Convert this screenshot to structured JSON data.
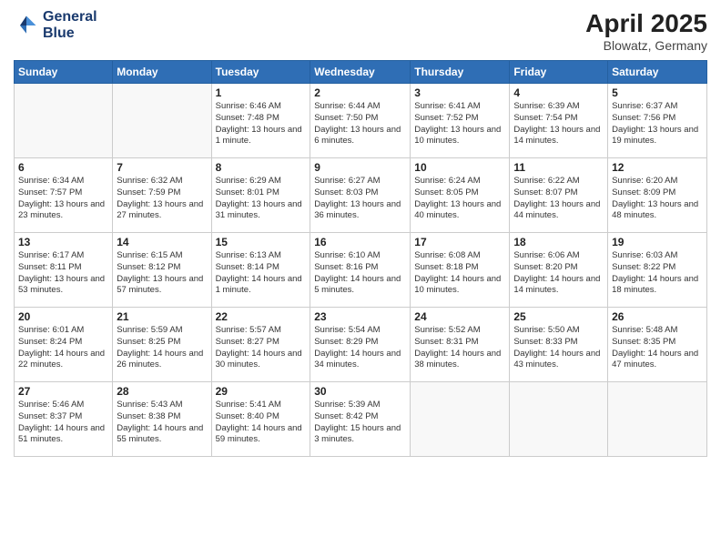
{
  "logo": {
    "line1": "General",
    "line2": "Blue"
  },
  "title": "April 2025",
  "location": "Blowatz, Germany",
  "days_of_week": [
    "Sunday",
    "Monday",
    "Tuesday",
    "Wednesday",
    "Thursday",
    "Friday",
    "Saturday"
  ],
  "weeks": [
    [
      {
        "num": "",
        "info": ""
      },
      {
        "num": "",
        "info": ""
      },
      {
        "num": "1",
        "info": "Sunrise: 6:46 AM\nSunset: 7:48 PM\nDaylight: 13 hours and 1 minute."
      },
      {
        "num": "2",
        "info": "Sunrise: 6:44 AM\nSunset: 7:50 PM\nDaylight: 13 hours and 6 minutes."
      },
      {
        "num": "3",
        "info": "Sunrise: 6:41 AM\nSunset: 7:52 PM\nDaylight: 13 hours and 10 minutes."
      },
      {
        "num": "4",
        "info": "Sunrise: 6:39 AM\nSunset: 7:54 PM\nDaylight: 13 hours and 14 minutes."
      },
      {
        "num": "5",
        "info": "Sunrise: 6:37 AM\nSunset: 7:56 PM\nDaylight: 13 hours and 19 minutes."
      }
    ],
    [
      {
        "num": "6",
        "info": "Sunrise: 6:34 AM\nSunset: 7:57 PM\nDaylight: 13 hours and 23 minutes."
      },
      {
        "num": "7",
        "info": "Sunrise: 6:32 AM\nSunset: 7:59 PM\nDaylight: 13 hours and 27 minutes."
      },
      {
        "num": "8",
        "info": "Sunrise: 6:29 AM\nSunset: 8:01 PM\nDaylight: 13 hours and 31 minutes."
      },
      {
        "num": "9",
        "info": "Sunrise: 6:27 AM\nSunset: 8:03 PM\nDaylight: 13 hours and 36 minutes."
      },
      {
        "num": "10",
        "info": "Sunrise: 6:24 AM\nSunset: 8:05 PM\nDaylight: 13 hours and 40 minutes."
      },
      {
        "num": "11",
        "info": "Sunrise: 6:22 AM\nSunset: 8:07 PM\nDaylight: 13 hours and 44 minutes."
      },
      {
        "num": "12",
        "info": "Sunrise: 6:20 AM\nSunset: 8:09 PM\nDaylight: 13 hours and 48 minutes."
      }
    ],
    [
      {
        "num": "13",
        "info": "Sunrise: 6:17 AM\nSunset: 8:11 PM\nDaylight: 13 hours and 53 minutes."
      },
      {
        "num": "14",
        "info": "Sunrise: 6:15 AM\nSunset: 8:12 PM\nDaylight: 13 hours and 57 minutes."
      },
      {
        "num": "15",
        "info": "Sunrise: 6:13 AM\nSunset: 8:14 PM\nDaylight: 14 hours and 1 minute."
      },
      {
        "num": "16",
        "info": "Sunrise: 6:10 AM\nSunset: 8:16 PM\nDaylight: 14 hours and 5 minutes."
      },
      {
        "num": "17",
        "info": "Sunrise: 6:08 AM\nSunset: 8:18 PM\nDaylight: 14 hours and 10 minutes."
      },
      {
        "num": "18",
        "info": "Sunrise: 6:06 AM\nSunset: 8:20 PM\nDaylight: 14 hours and 14 minutes."
      },
      {
        "num": "19",
        "info": "Sunrise: 6:03 AM\nSunset: 8:22 PM\nDaylight: 14 hours and 18 minutes."
      }
    ],
    [
      {
        "num": "20",
        "info": "Sunrise: 6:01 AM\nSunset: 8:24 PM\nDaylight: 14 hours and 22 minutes."
      },
      {
        "num": "21",
        "info": "Sunrise: 5:59 AM\nSunset: 8:25 PM\nDaylight: 14 hours and 26 minutes."
      },
      {
        "num": "22",
        "info": "Sunrise: 5:57 AM\nSunset: 8:27 PM\nDaylight: 14 hours and 30 minutes."
      },
      {
        "num": "23",
        "info": "Sunrise: 5:54 AM\nSunset: 8:29 PM\nDaylight: 14 hours and 34 minutes."
      },
      {
        "num": "24",
        "info": "Sunrise: 5:52 AM\nSunset: 8:31 PM\nDaylight: 14 hours and 38 minutes."
      },
      {
        "num": "25",
        "info": "Sunrise: 5:50 AM\nSunset: 8:33 PM\nDaylight: 14 hours and 43 minutes."
      },
      {
        "num": "26",
        "info": "Sunrise: 5:48 AM\nSunset: 8:35 PM\nDaylight: 14 hours and 47 minutes."
      }
    ],
    [
      {
        "num": "27",
        "info": "Sunrise: 5:46 AM\nSunset: 8:37 PM\nDaylight: 14 hours and 51 minutes."
      },
      {
        "num": "28",
        "info": "Sunrise: 5:43 AM\nSunset: 8:38 PM\nDaylight: 14 hours and 55 minutes."
      },
      {
        "num": "29",
        "info": "Sunrise: 5:41 AM\nSunset: 8:40 PM\nDaylight: 14 hours and 59 minutes."
      },
      {
        "num": "30",
        "info": "Sunrise: 5:39 AM\nSunset: 8:42 PM\nDaylight: 15 hours and 3 minutes."
      },
      {
        "num": "",
        "info": ""
      },
      {
        "num": "",
        "info": ""
      },
      {
        "num": "",
        "info": ""
      }
    ]
  ]
}
